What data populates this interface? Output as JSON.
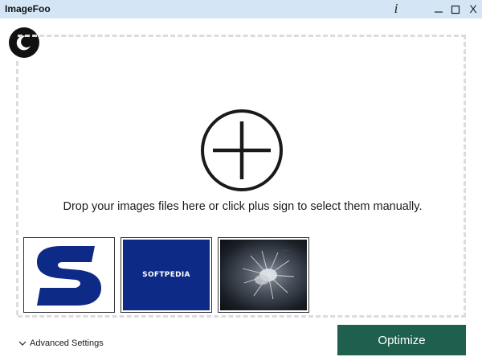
{
  "window": {
    "title": "ImageFoo",
    "info_label": "i",
    "close_label": "X"
  },
  "drop_zone": {
    "hint": "Drop your images files here or click plus sign to select them manually."
  },
  "thumbnails": [
    {
      "name": "s-logo"
    },
    {
      "name": "softpedia-logo",
      "text": "SOFTPEDIA"
    },
    {
      "name": "spider-photo"
    }
  ],
  "footer": {
    "advanced_settings_label": "Advanced Settings",
    "optimize_label": "Optimize"
  },
  "colors": {
    "titlebar": "#d4e6f5",
    "optimize_button": "#1e5f4d",
    "dashed_border": "#dcdcdc",
    "softpedia_blue": "#0c2a86"
  },
  "icons": {
    "theme": "moon-icon",
    "add": "plus-circle-icon",
    "expand": "chevron-down-icon",
    "minimize": "minimize-icon",
    "maximize": "maximize-icon"
  }
}
